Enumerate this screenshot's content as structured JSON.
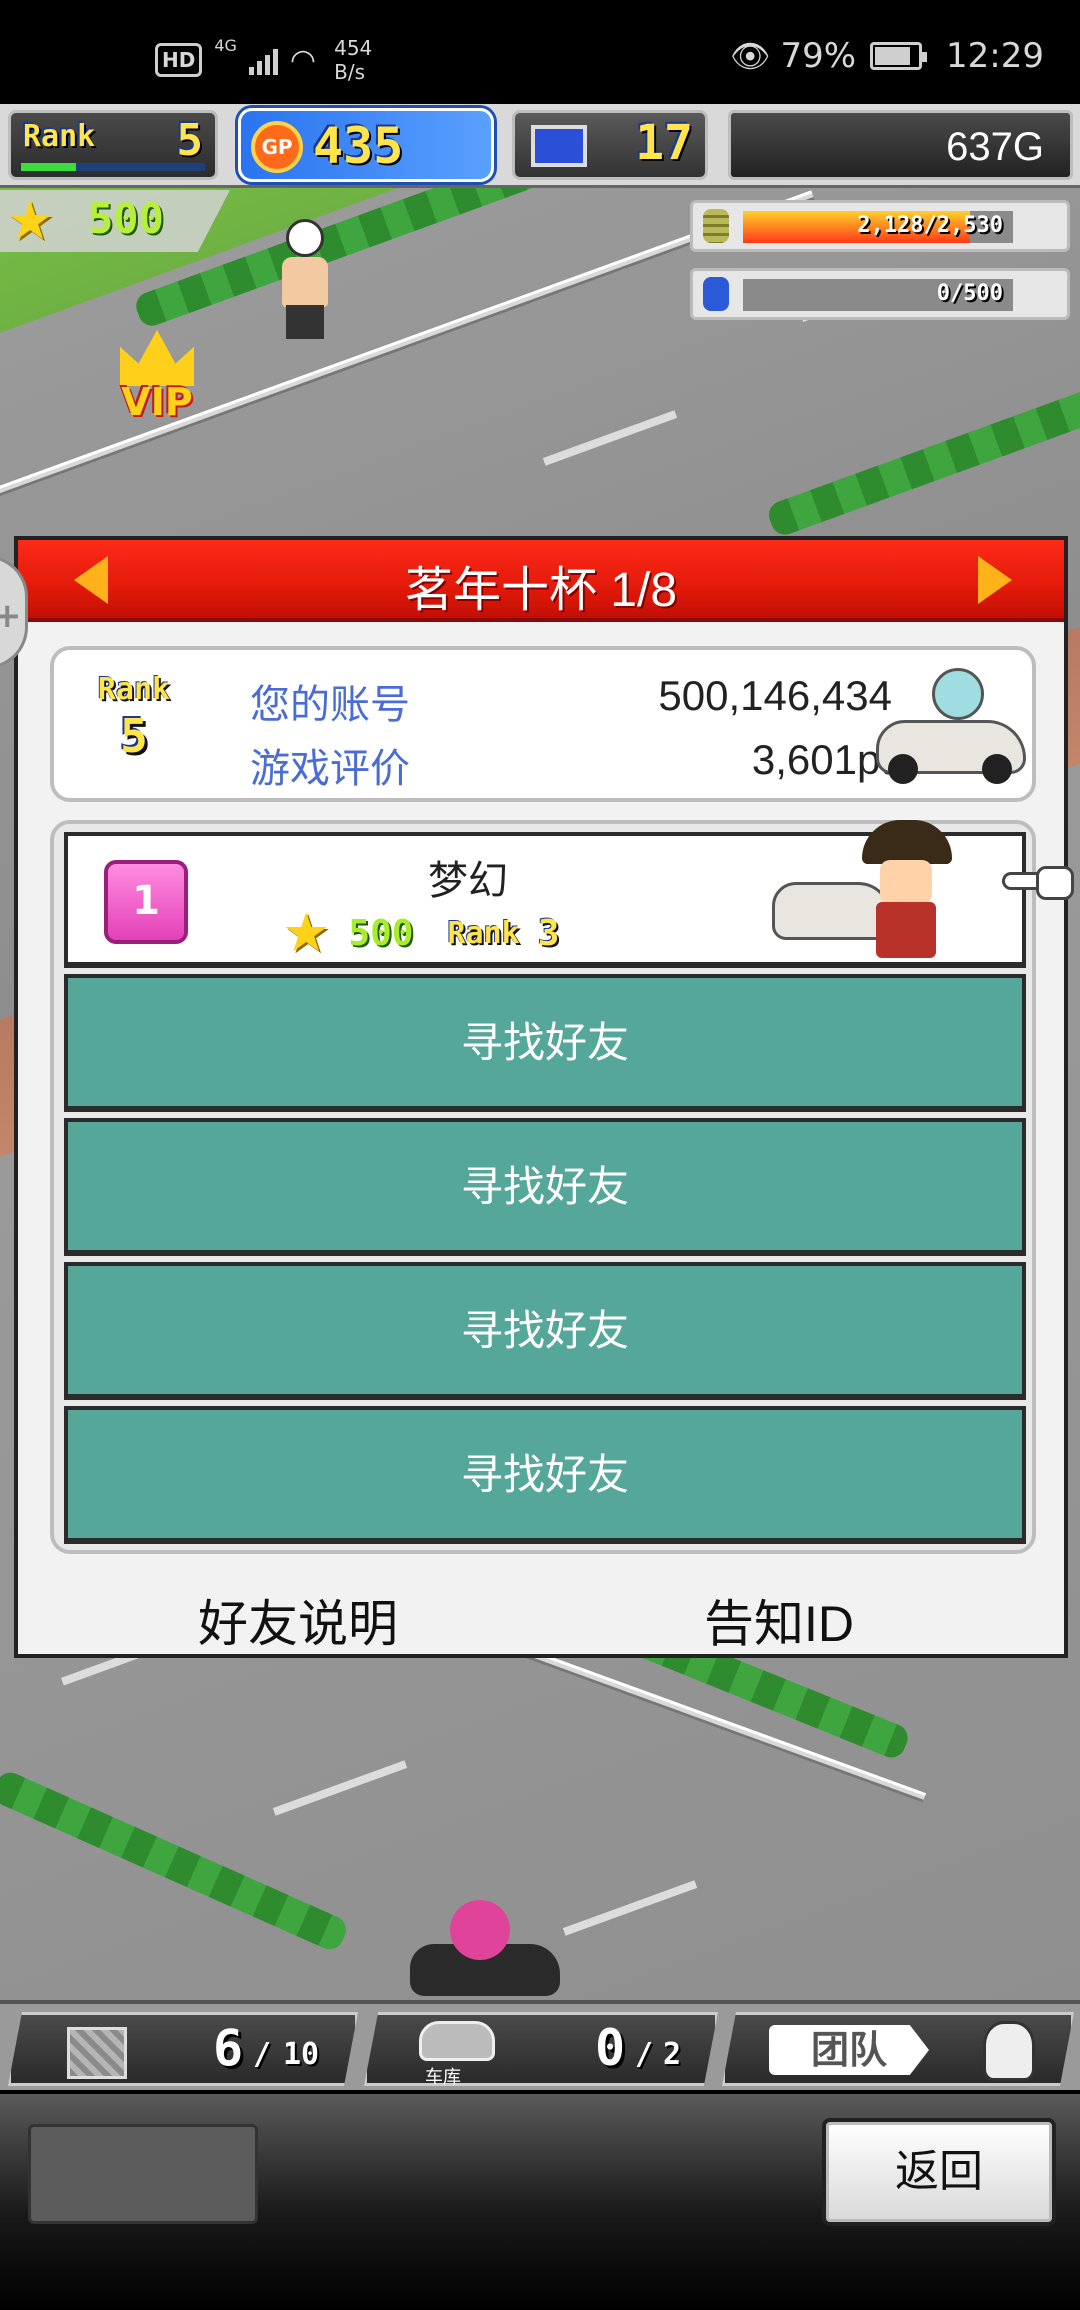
{
  "status_bar": {
    "hd": "HD",
    "network": "4G",
    "speed_value": "454",
    "speed_unit": "B/s",
    "battery": "79%",
    "time": "12:29"
  },
  "hud": {
    "rank_label": "Rank",
    "rank_value": "5",
    "gp_icon_label": "GP",
    "gp_value": "435",
    "computer_value": "17",
    "money": "637G",
    "stars": "500",
    "fuel_meter": {
      "text": "2,128/2,530",
      "fraction": 0.84
    },
    "bottle_meter": {
      "text": "0/500",
      "fraction": 0.0
    },
    "vip_label": "VIP"
  },
  "dialog": {
    "title": "茗年十杯 1/8",
    "account": {
      "rank_label": "Rank",
      "rank_value": "5",
      "id_label": "您的账号",
      "id_value": "500,146,434",
      "rating_label": "游戏评价",
      "rating_value": "3,601pt"
    },
    "friend": {
      "position": "1",
      "name": "梦幻",
      "stars": "500",
      "rank_label": "Rank",
      "rank_value": "3"
    },
    "find_buttons": [
      "寻找好友",
      "寻找好友",
      "寻找好友",
      "寻找好友"
    ],
    "footer_left": "好友说明",
    "footer_right": "告知ID"
  },
  "bottom_bar": {
    "storage_current": "6",
    "storage_max": "10",
    "garage_label": "车库",
    "garage_current": "0",
    "garage_max": "2",
    "team_label": "团队"
  },
  "back_button": "返回",
  "colors": {
    "dialog_header": "#e31a0a",
    "find_button": "#54a799",
    "gp_badge": "#2a74f0"
  },
  "icons": [
    "hd-icon",
    "signal-icon",
    "wifi-icon",
    "eye-icon",
    "battery-icon",
    "star-icon",
    "coin-stack-icon",
    "bottle-icon",
    "computer-icon",
    "crate-icon",
    "garage-icon",
    "team-face-icon",
    "pointing-hand-icon",
    "left-arrow-icon",
    "right-arrow-icon"
  ]
}
